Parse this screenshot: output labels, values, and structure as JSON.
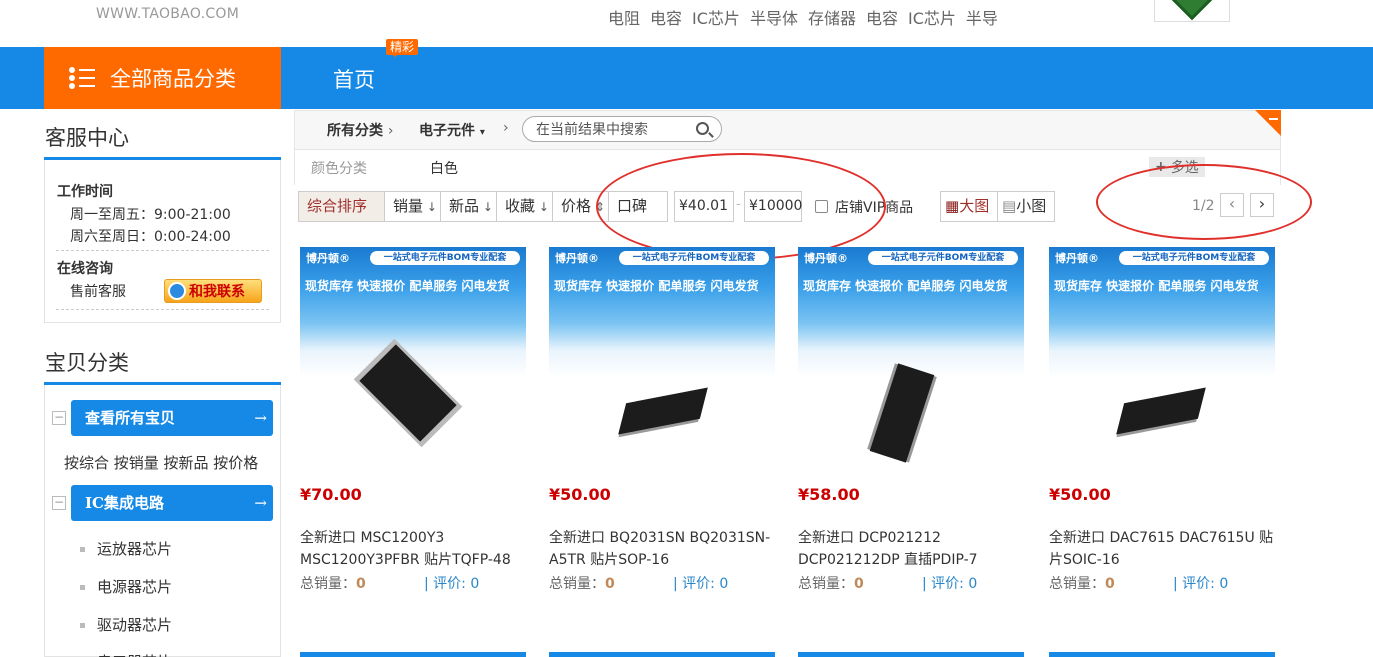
{
  "header": {
    "logo_url_text": "WWW.TAOBAO.COM",
    "hot_words": [
      "电阻",
      "电容",
      "IC芯片",
      "半导体",
      "存储器",
      "电容",
      "IC芯片",
      "半导"
    ]
  },
  "nav": {
    "all_categories": "全部商品分类",
    "home": "首页",
    "home_badge": "精彩"
  },
  "sidebar": {
    "service_title": "客服中心",
    "work_time_label": "工作时间",
    "weekday_hours": "周一至周五：9:00-21:00",
    "weekend_hours": "周六至周日：0:00-24:00",
    "online_label": "在线咨询",
    "presale_label": "售前客服",
    "contact_button": "和我联系",
    "category_title": "宝贝分类",
    "view_all_button": "查看所有宝贝",
    "sort_links": "按综合 按销量 按新品 按价格",
    "ic_button": "IC集成电路",
    "sub_items": [
      "运放器芯片",
      "电源器芯片",
      "驱动器芯片",
      "串口器芯片"
    ]
  },
  "filter": {
    "breadcrumb_all": "所有分类",
    "breadcrumb_cat": "电子元件",
    "search_placeholder": "在当前结果中搜索",
    "color_label": "颜色分类",
    "color_value": "白色",
    "multi_select": "多选"
  },
  "sortbar": {
    "composite": "综合排序",
    "sales": "销量",
    "new": "新品",
    "favorites": "收藏",
    "price": "价格",
    "reputation": "口碑",
    "price_min": "¥40.01",
    "price_max": "¥10000",
    "vip_label": "店铺VIP商品",
    "big_view": "大图",
    "small_view": "小图",
    "page_indicator": "1/2"
  },
  "colors": {
    "nav_blue": "#1589e5",
    "category_orange": "#ff6a00",
    "price_red": "#cc0000",
    "annotation_red": "#e0302c"
  },
  "products": [
    {
      "price": "¥70.00",
      "title": "全新进口 MSC1200Y3 MSC1200Y3PFBR 贴片TQFP-48",
      "sales_label": "总销量：",
      "sales": "0",
      "review_label": "评价: 0",
      "brand": "博丹顿®",
      "slogan": "一站式电子元件BOM专业配套",
      "tagline": "现货库存 快速报价 配单服务 闪电发货"
    },
    {
      "price": "¥50.00",
      "title": "全新进口 BQ2031SN BQ2031SN-A5TR 贴片SOP-16",
      "sales_label": "总销量：",
      "sales": "0",
      "review_label": "评价: 0",
      "brand": "博丹顿®",
      "slogan": "一站式电子元件BOM专业配套",
      "tagline": "现货库存 快速报价 配单服务 闪电发货"
    },
    {
      "price": "¥58.00",
      "title": "全新进口 DCP021212 DCP021212DP 直插PDIP-7",
      "sales_label": "总销量：",
      "sales": "0",
      "review_label": "评价: 0",
      "brand": "博丹顿®",
      "slogan": "一站式电子元件BOM专业配套",
      "tagline": "现货库存 快速报价 配单服务 闪电发货"
    },
    {
      "price": "¥50.00",
      "title": "全新进口 DAC7615 DAC7615U 贴片SOIC-16",
      "sales_label": "总销量：",
      "sales": "0",
      "review_label": "评价: 0",
      "brand": "博丹顿®",
      "slogan": "一站式电子元件BOM专业配套",
      "tagline": "现货库存 快速报价 配单服务 闪电发货"
    }
  ]
}
